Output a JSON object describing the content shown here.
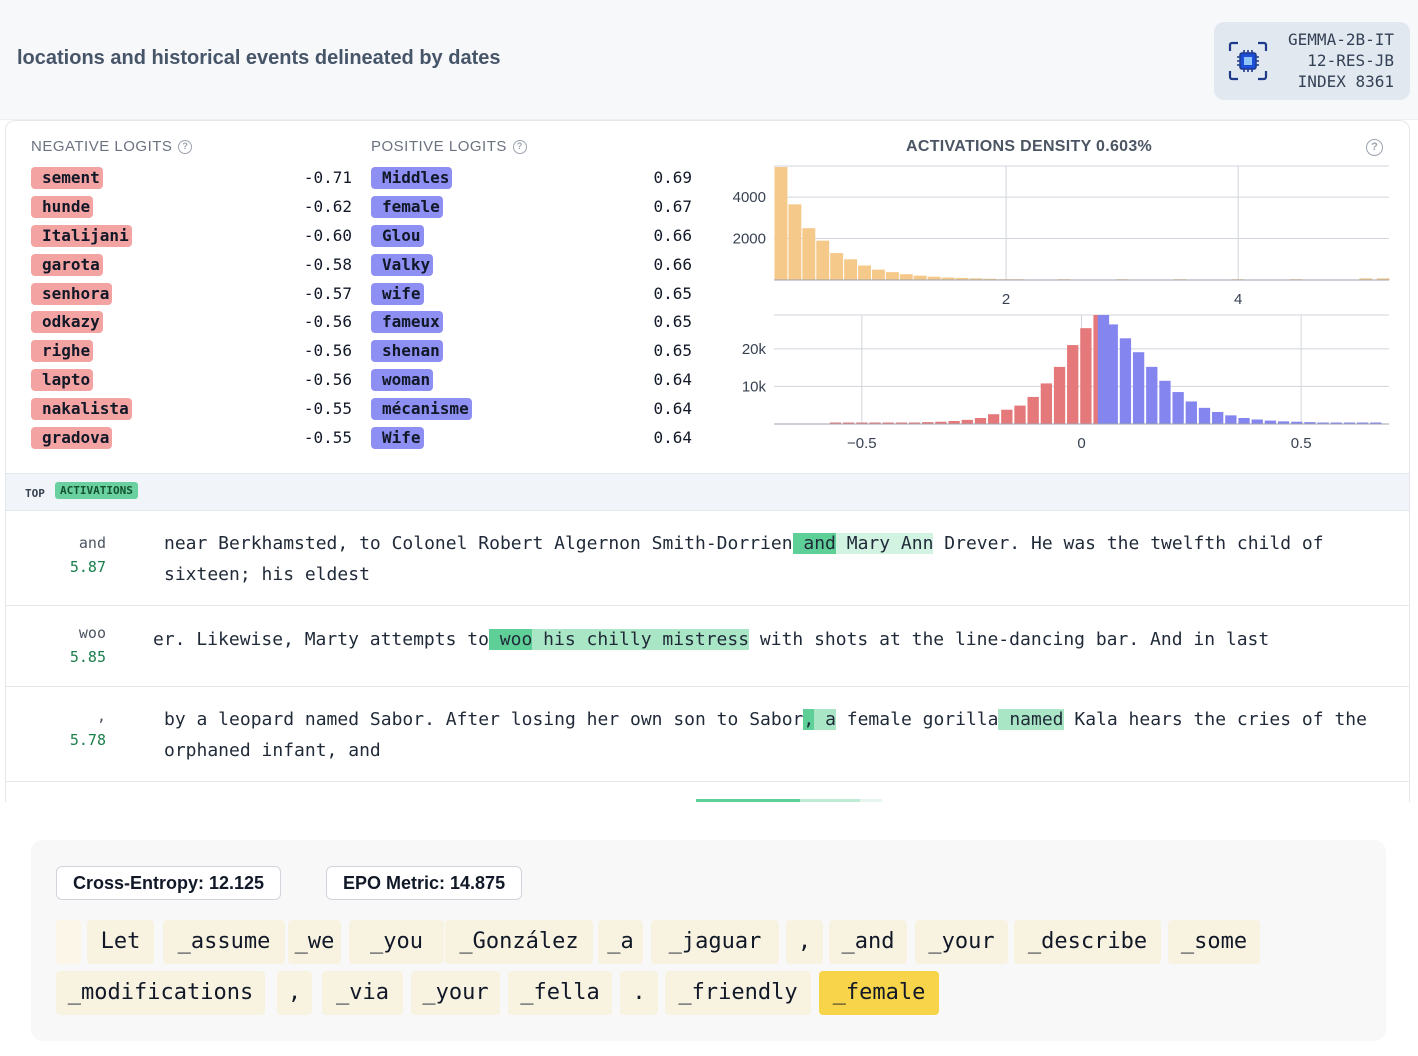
{
  "feature": {
    "title": "locations and historical events delineated by dates",
    "model": [
      "GEMMA-2B-IT",
      "12-RES-JB",
      "INDEX 8361"
    ],
    "model_icon": "cpu-chip-icon"
  },
  "logits": {
    "negative_header": "NEGATIVE LOGITS",
    "positive_header": "POSITIVE LOGITS",
    "negative": [
      {
        "token": "sement",
        "value": "-0.71"
      },
      {
        "token": "hunde",
        "value": "-0.62"
      },
      {
        "token": "Italijani",
        "value": "-0.60"
      },
      {
        "token": "garota",
        "value": "-0.58"
      },
      {
        "token": "senhora",
        "value": "-0.57"
      },
      {
        "token": "odkazy",
        "value": "-0.56"
      },
      {
        "token": "righe",
        "value": "-0.56"
      },
      {
        "token": "lapto",
        "value": "-0.56"
      },
      {
        "token": "nakalista",
        "value": "-0.55"
      },
      {
        "token": "gradova",
        "value": "-0.55"
      }
    ],
    "positive": [
      {
        "token": "Middles",
        "value": "0.69"
      },
      {
        "token": "female",
        "value": "0.67"
      },
      {
        "token": "Glou",
        "value": "0.66"
      },
      {
        "token": "Valky",
        "value": "0.66"
      },
      {
        "token": "wife",
        "value": "0.65"
      },
      {
        "token": "fameux",
        "value": "0.65"
      },
      {
        "token": "shenan",
        "value": "0.65"
      },
      {
        "token": "woman",
        "value": "0.64"
      },
      {
        "token": "mécanisme",
        "value": "0.64"
      },
      {
        "token": "Wife",
        "value": "0.64"
      }
    ]
  },
  "density": {
    "title": "ACTIVATIONS DENSITY 0.603%"
  },
  "chart_data": [
    {
      "type": "bar",
      "title": "ACTIVATIONS DENSITY 0.603%",
      "xlim": [
        0,
        5.3
      ],
      "ylim": [
        0,
        5500
      ],
      "x_ticks": [
        "2",
        "4"
      ],
      "y_ticks": [
        "2000",
        "4000"
      ],
      "grid": true,
      "color": "#f5c98a",
      "bin_width": 0.12,
      "x": [
        0.06,
        0.18,
        0.3,
        0.42,
        0.54,
        0.66,
        0.78,
        0.9,
        1.02,
        1.14,
        1.26,
        1.38,
        1.5,
        1.62,
        1.74,
        1.86,
        1.98,
        2.1,
        2.5,
        3.0,
        3.5,
        4.0,
        4.5,
        5.1,
        5.25
      ],
      "values": [
        5450,
        3650,
        2500,
        1900,
        1300,
        1000,
        700,
        500,
        380,
        280,
        210,
        160,
        120,
        100,
        80,
        60,
        40,
        40,
        40,
        40,
        40,
        40,
        40,
        80,
        80
      ]
    },
    {
      "type": "bar",
      "xlim": [
        -0.7,
        0.7
      ],
      "ylim": [
        0,
        29000
      ],
      "x_ticks": [
        "−0.5",
        "0",
        "0.5"
      ],
      "y_ticks": [
        "10k",
        "20k"
      ],
      "grid": true,
      "series": [
        {
          "name": "negative",
          "color": "#e5787a",
          "x": [
            -0.56,
            -0.53,
            -0.5,
            -0.47,
            -0.44,
            -0.41,
            -0.38,
            -0.35,
            -0.32,
            -0.29,
            -0.26,
            -0.23,
            -0.2,
            -0.17,
            -0.14,
            -0.11,
            -0.08,
            -0.05,
            -0.02
          ],
          "values": [
            400,
            400,
            400,
            400,
            400,
            400,
            400,
            500,
            600,
            800,
            1100,
            1600,
            2600,
            3800,
            4900,
            7200,
            10800,
            15200,
            21000
          ]
        },
        {
          "name": "negative-peak",
          "color": "#e5787a",
          "x": [
            0.01,
            0.04
          ],
          "values": [
            25500,
            29000
          ]
        },
        {
          "name": "positive",
          "color": "#8585ef",
          "x": [
            0.05,
            0.07,
            0.1,
            0.13,
            0.16,
            0.19,
            0.22,
            0.25,
            0.28,
            0.31,
            0.34,
            0.37,
            0.4,
            0.43,
            0.46,
            0.49,
            0.52,
            0.55,
            0.58,
            0.61,
            0.64,
            0.67
          ],
          "values": [
            29000,
            26500,
            22800,
            19100,
            15200,
            11500,
            8500,
            6000,
            4300,
            3200,
            2300,
            1600,
            1200,
            900,
            700,
            600,
            500,
            400,
            400,
            400,
            400,
            400
          ]
        }
      ]
    }
  ],
  "top_activations": {
    "label": "TOP",
    "badge": "ACTIVATIONS",
    "rows": [
      {
        "token": "and",
        "value": "5.87",
        "segments": [
          {
            "text": "near Berkhamsted, to Colonel Robert Algernon Smith-Dorrien",
            "hl": ""
          },
          {
            "text": " and",
            "hl": "hl1"
          },
          {
            "text": " Mary Ann",
            "hl": "hl3"
          },
          {
            "text": " Drever. He was the twelfth child of sixteen; his eldest",
            "hl": ""
          }
        ]
      },
      {
        "token": "woo",
        "value": "5.85",
        "segments": [
          {
            "text": "er. Likewise, Marty attempts to",
            "hl": ""
          },
          {
            "text": " woo",
            "hl": "hl1"
          },
          {
            "text": " his",
            "hl": "hl2"
          },
          {
            "text": " chilly mistress",
            "hl": "hl2"
          },
          {
            "text": " with shots at the line-dancing bar. And in last",
            "hl": ""
          }
        ]
      },
      {
        "token": ",",
        "value": "5.78",
        "segments": [
          {
            "text": "by a leopard named Sabor. After losing her own son to Sabor",
            "hl": ""
          },
          {
            "text": ",",
            "hl": "hl1"
          },
          {
            "text": " a",
            "hl": "hl2"
          },
          {
            "text": " female gorilla",
            "hl": ""
          },
          {
            "text": " named",
            "hl": "hl2"
          },
          {
            "text": " Kala hears the cries of the orphaned infant, and",
            "hl": ""
          }
        ]
      }
    ]
  },
  "metrics": {
    "cross_entropy": "Cross-Entropy: 12.125",
    "epo": "EPO Metric: 14.875"
  },
  "prompt_tokens": [
    "",
    "Let",
    "_assume",
    "_we",
    "_you",
    "_González",
    "_a",
    "_jaguar",
    ",",
    "_and",
    "_your",
    "_describe",
    "_some",
    "_modifications",
    ",",
    "_via",
    "_your",
    "_fella",
    ".",
    "_friendly",
    "_female"
  ]
}
